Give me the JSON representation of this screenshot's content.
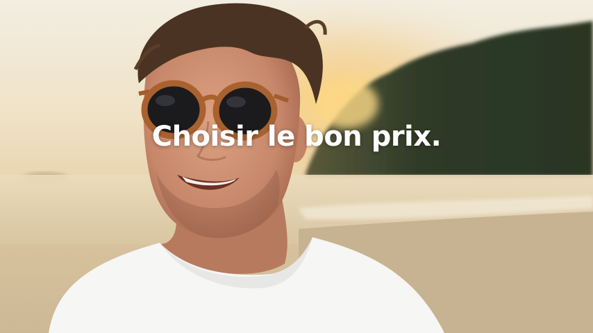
{
  "caption": "Choisir le bon prix.",
  "colors": {
    "sky": "#f1e8d6",
    "sun_glow": "#f6c66a",
    "trees": "#2d3a26",
    "sea": "#e7d7b5",
    "sand": "#c9b594",
    "skin": "#c98b6a",
    "hair": "#4a3424",
    "glasses_frame": "#a8602e",
    "lens": "#1c1c1f",
    "shirt": "#f7f7f7",
    "caption": "#ffffff"
  }
}
